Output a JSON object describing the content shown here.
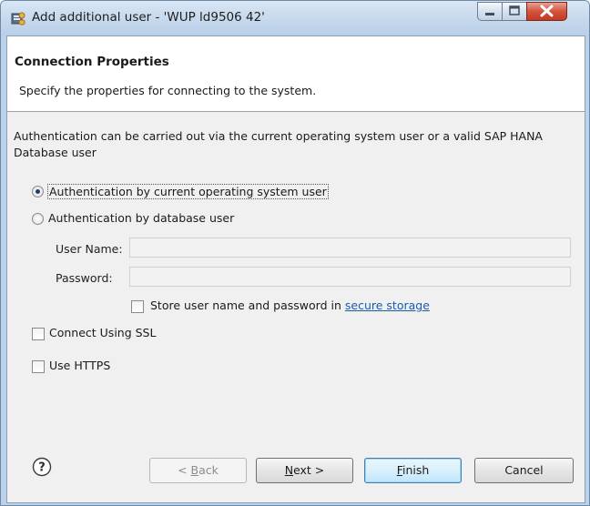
{
  "window": {
    "title": "Add additional user - 'WUP ld9506 42'",
    "icons": {
      "app": "database-add-user-icon",
      "minimize": "minimize-icon",
      "maximize": "maximize-icon",
      "close": "close-icon"
    }
  },
  "header": {
    "title": "Connection Properties",
    "description": "Specify the properties for connecting to the system."
  },
  "body": {
    "intro": "Authentication can be carried out via the current operating system user or a valid SAP HANA Database user",
    "auth_options": [
      {
        "label": "Authentication by current operating system user",
        "selected": true
      },
      {
        "label": "Authentication by database user",
        "selected": false
      }
    ],
    "user_name": {
      "label": "User Name:",
      "value": "",
      "enabled": false
    },
    "password": {
      "label": "Password:",
      "value": "",
      "enabled": false
    },
    "store_credentials": {
      "label": "Store user name and password in",
      "link": "secure storage",
      "checked": false
    },
    "connect_ssl": {
      "label": "Connect Using SSL",
      "checked": false
    },
    "use_https": {
      "label": "Use HTTPS",
      "checked": false
    }
  },
  "footer": {
    "help_icon": "help-icon",
    "buttons": {
      "back": {
        "prefix": "< ",
        "mnemonic": "B",
        "rest": "ack",
        "enabled": false
      },
      "next": {
        "mnemonic": "N",
        "rest": "ext >",
        "enabled": true
      },
      "finish": {
        "mnemonic": "F",
        "rest": "inish",
        "enabled": true,
        "default": true
      },
      "cancel": {
        "label": "Cancel",
        "enabled": true
      }
    }
  }
}
